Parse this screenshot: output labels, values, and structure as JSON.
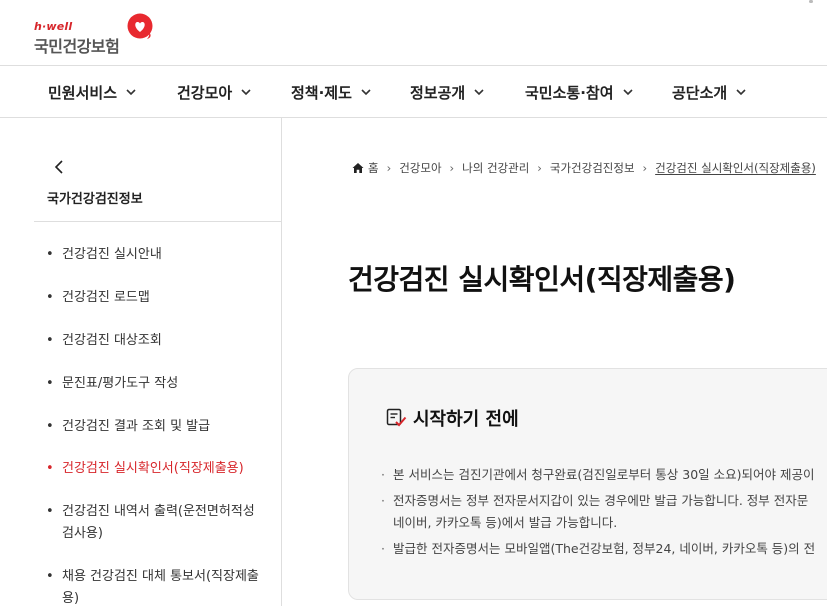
{
  "header": {
    "logo_hwell": "h·well",
    "logo_name": "국민건강보험"
  },
  "gnb": {
    "items": [
      {
        "label": "민원서비스"
      },
      {
        "label": "건강모아"
      },
      {
        "label": "정책·제도"
      },
      {
        "label": "정보공개"
      },
      {
        "label": "국민소통·참여"
      },
      {
        "label": "공단소개"
      }
    ]
  },
  "sidebar": {
    "title": "국가건강검진정보",
    "items": [
      {
        "label": "건강검진 실시안내"
      },
      {
        "label": "건강검진 로드맵"
      },
      {
        "label": "건강검진 대상조회"
      },
      {
        "label": "문진표/평가도구 작성"
      },
      {
        "label": "건강검진 결과 조회 및 발급"
      },
      {
        "label": "건강검진 실시확인서(직장제출용)"
      },
      {
        "label_line1": "건강검진 내역서 출력(운전면허적성",
        "label_line2": "검사용)"
      },
      {
        "label_line1": "채용 건강검진 대체 통보서(직장제출",
        "label_line2": "용)"
      }
    ]
  },
  "breadcrumb": {
    "items": [
      "홈",
      "건강모아",
      "나의 건강관리",
      "국가건강검진정보",
      "건강검진 실시확인서(직장제출용)"
    ]
  },
  "main": {
    "title": "건강검진 실시확인서(직장제출용)",
    "notice": {
      "title": "시작하기 전에",
      "items": [
        {
          "line1": "본 서비스는 검진기관에서 청구완료(검진일로부터 통상 30일 소요)되어야 제공이"
        },
        {
          "line1": "전자증명서는 정부 전자문서지갑이 있는 경우에만 발급 가능합니다. 정부 전자문",
          "line2": "네이버, 카카오톡 등)에서 발급 가능합니다."
        },
        {
          "line1": "발급한 전자증명서는 모바일앱(The건강보험, 정부24, 네이버, 카카오톡 등)의 전"
        }
      ]
    }
  },
  "colors": {
    "brand_red": "#d7262b",
    "border": "#dedede",
    "notice_bg": "#f6f6f6"
  }
}
